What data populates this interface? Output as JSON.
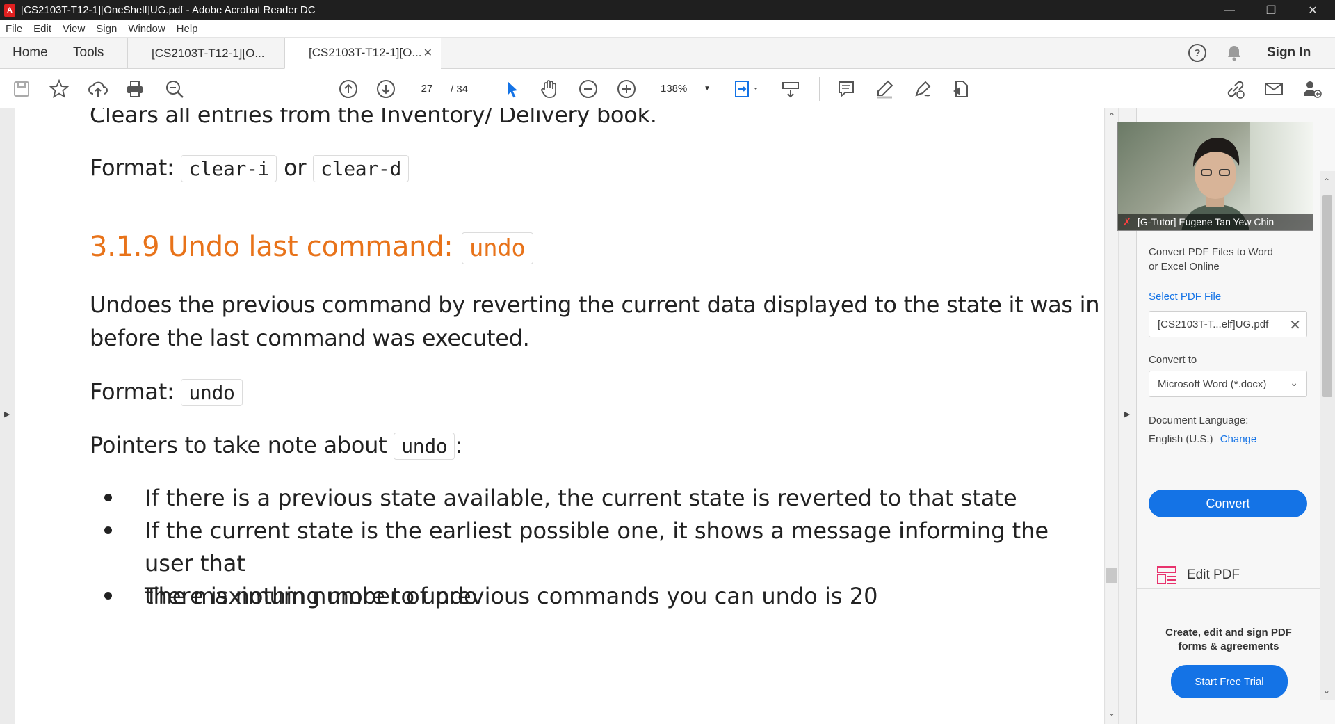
{
  "window": {
    "title": "[CS2103T-T12-1][OneShelf]UG.pdf - Adobe Acrobat Reader DC",
    "controls": {
      "minimize": "—",
      "restore": "❐",
      "close": "✕"
    }
  },
  "menubar": [
    "File",
    "Edit",
    "View",
    "Sign",
    "Window",
    "Help"
  ],
  "tabs": {
    "home": "Home",
    "tools": "Tools",
    "doc1": "[CS2103T-T12-1][O...",
    "doc2": "[CS2103T-T12-1][O...",
    "sign_in": "Sign In"
  },
  "toolbar": {
    "page_current": "27",
    "page_total": "/ 34",
    "zoom": "138%"
  },
  "document": {
    "line_clears": "Clears all entries from the Inventory/ Delivery book.",
    "format1_label": "Format:",
    "format1_code1": "clear-i",
    "format1_or": "or",
    "format1_code2": "clear-d",
    "heading_text": "3.1.9 Undo last command:",
    "heading_code": "undo",
    "desc_line1": "Undoes the previous command by reverting the current data displayed to the state it was in",
    "desc_line2": "before the last command was executed.",
    "format2_label": "Format:",
    "format2_code": "undo",
    "pointers_text": "Pointers to take note about",
    "pointers_code": "undo",
    "pointers_colon": ":",
    "bullets": [
      [
        "If there is a previous state available, the current state is reverted to that state"
      ],
      [
        "If the current state is the earliest possible one, it shows a message informing the user that",
        "there is nothing more to undo"
      ],
      [
        "The maximum number of previous commands you can undo is 20"
      ]
    ]
  },
  "right_pane": {
    "convert_title_1": "Convert PDF Files to Word",
    "convert_title_2": "or Excel Online",
    "select_pdf": "Select PDF File",
    "selected_file": "[CS2103T-T...elf]UG.pdf",
    "convert_to": "Convert to",
    "format_option": "Microsoft Word (*.docx)",
    "doc_language_label": "Document Language:",
    "doc_language_value": "English (U.S.)",
    "change_link": "Change",
    "convert_button": "Convert",
    "edit_pdf": "Edit PDF",
    "promo_line1": "Create, edit and sign PDF",
    "promo_line2": "forms & agreements",
    "trial_button": "Start Free Trial"
  },
  "webcam": {
    "caption": "[G-Tutor] Eugene Tan Yew Chin"
  },
  "colors": {
    "heading_orange": "#e8731a",
    "accent_blue": "#1473e6",
    "titlebar": "#1f1f1f"
  }
}
